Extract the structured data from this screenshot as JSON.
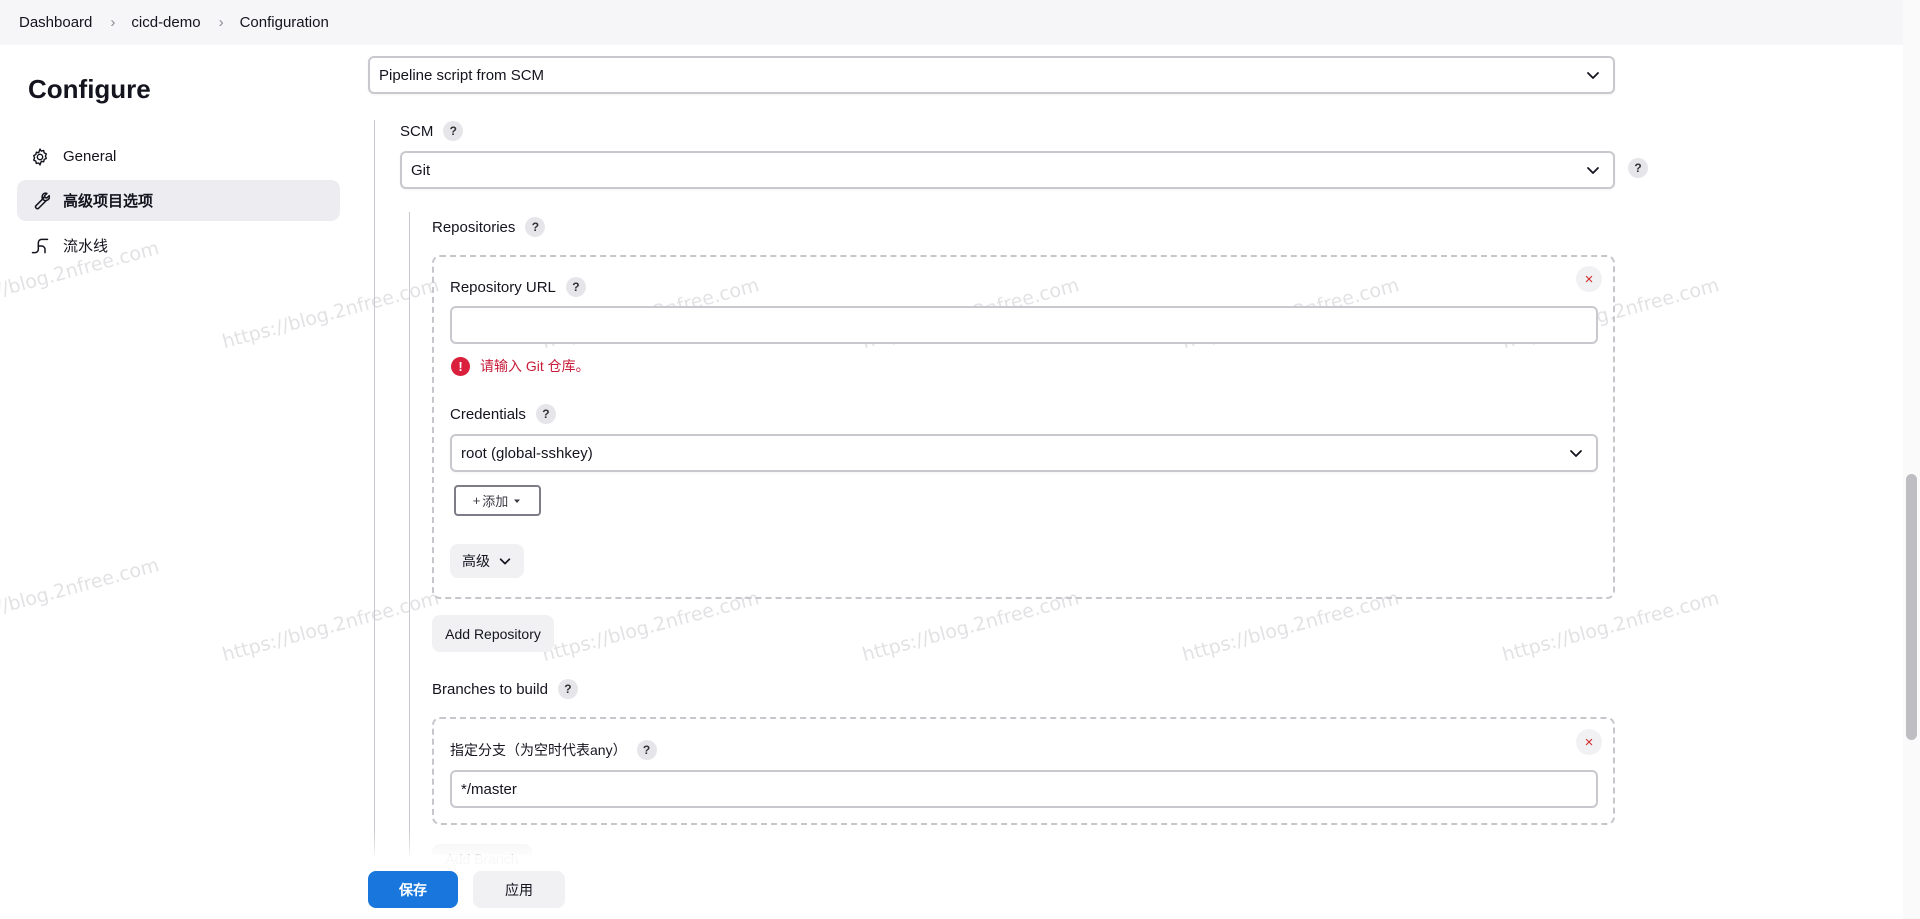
{
  "breadcrumb": {
    "items": [
      "Dashboard",
      "cicd-demo",
      "Configuration"
    ],
    "sep": "›"
  },
  "sidebar": {
    "title": "Configure",
    "items": [
      {
        "label": "General",
        "icon": "gear-icon"
      },
      {
        "label": "高级项目选项",
        "icon": "wrench-icon"
      },
      {
        "label": "流水线",
        "icon": "pipeline-icon"
      }
    ]
  },
  "definition": {
    "value": "Pipeline script from SCM"
  },
  "scm": {
    "label": "SCM",
    "value": "Git"
  },
  "repositories": {
    "label": "Repositories",
    "url_label": "Repository URL",
    "url_value": "",
    "error": "请输入 Git 仓库。",
    "credentials_label": "Credentials",
    "credentials_value": "root (global-sshkey)",
    "add_label": "添加",
    "advanced_label": "高级",
    "add_repository_label": "Add Repository",
    "remove": "×"
  },
  "branches": {
    "label": "Branches to build",
    "spec_label": "指定分支（为空时代表any）",
    "spec_value": "*/master",
    "add_branch_label": "Add Branch",
    "remove": "×"
  },
  "help_symbol": "?",
  "actions": {
    "save_label": "保存",
    "apply_label": "应用"
  },
  "watermark": "https://blog.2nfree.com",
  "colors": {
    "primary": "#1876dd",
    "error": "#d91f3c",
    "active_bg": "#ededf1"
  }
}
